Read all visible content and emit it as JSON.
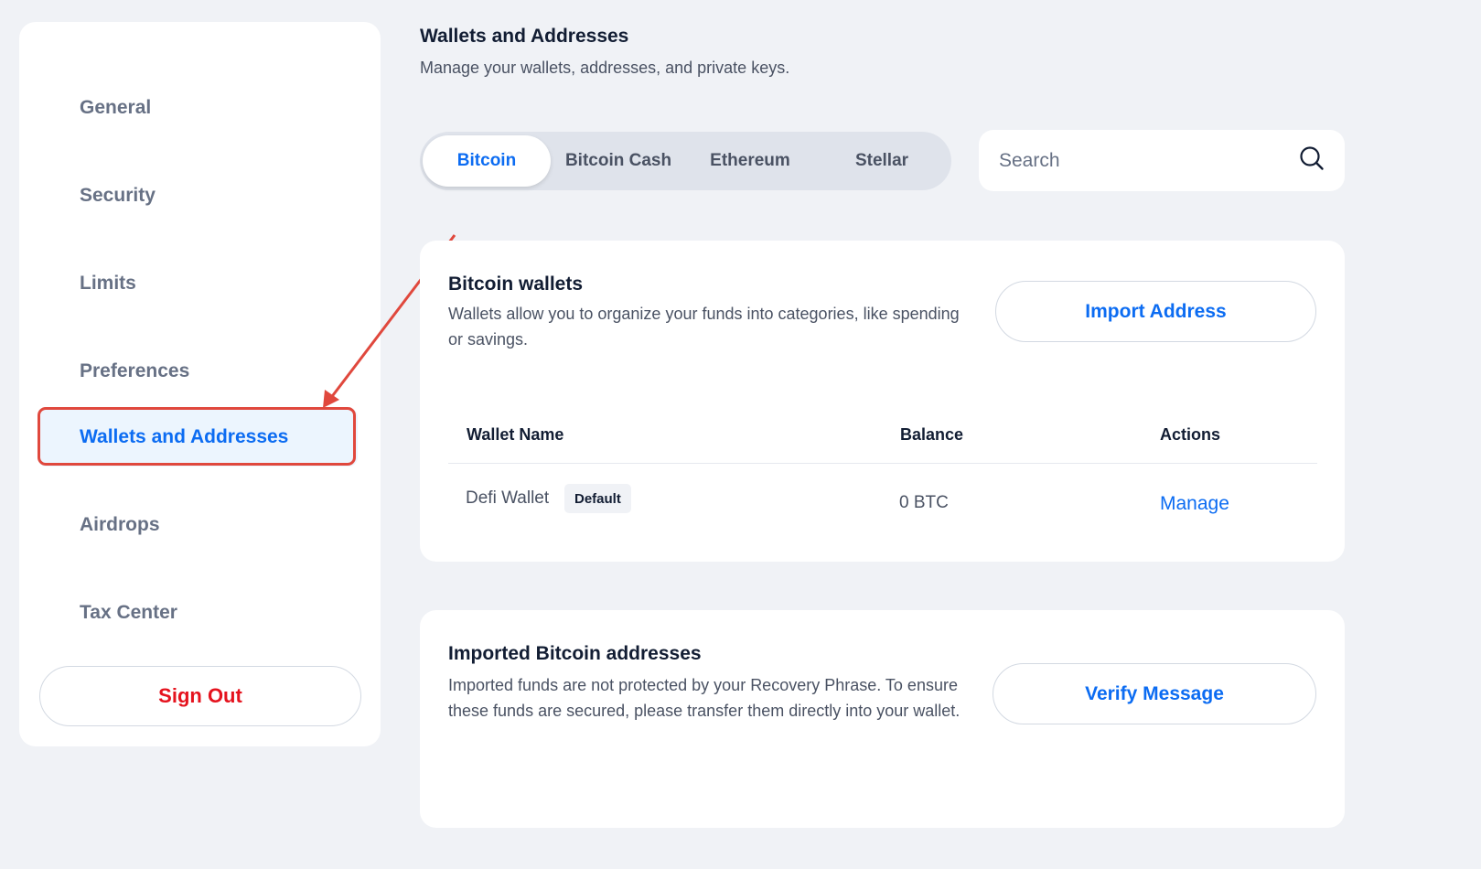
{
  "sidebar": {
    "items": [
      {
        "label": "General"
      },
      {
        "label": "Security"
      },
      {
        "label": "Limits"
      },
      {
        "label": "Preferences"
      },
      {
        "label": "Wallets and Addresses",
        "active": true
      },
      {
        "label": "Airdrops"
      },
      {
        "label": "Tax Center"
      }
    ],
    "sign_out_label": "Sign Out"
  },
  "header": {
    "title": "Wallets and Addresses",
    "subtitle": "Manage your wallets, addresses, and private keys."
  },
  "tabs": [
    {
      "label": "Bitcoin",
      "active": true
    },
    {
      "label": "Bitcoin Cash"
    },
    {
      "label": "Ethereum"
    },
    {
      "label": "Stellar"
    }
  ],
  "search": {
    "placeholder": "Search",
    "value": ""
  },
  "wallets_card": {
    "title": "Bitcoin wallets",
    "description": "Wallets allow you to organize your funds into categories, like spending or savings.",
    "button_label": "Import Address",
    "columns": [
      "Wallet Name",
      "Balance",
      "Actions"
    ],
    "rows": [
      {
        "name": "Defi Wallet",
        "badge": "Default",
        "balance": "0 BTC",
        "action": "Manage"
      }
    ]
  },
  "imported_card": {
    "title": "Imported Bitcoin addresses",
    "description": "Imported funds are not protected by your Recovery Phrase. To ensure these funds are secured, please transfer them directly into your wallet.",
    "button_label": "Verify Message"
  },
  "colors": {
    "accent": "#0c6cf2",
    "danger": "#e5131e",
    "annotation": "#e0483d",
    "background": "#f0f2f6"
  }
}
